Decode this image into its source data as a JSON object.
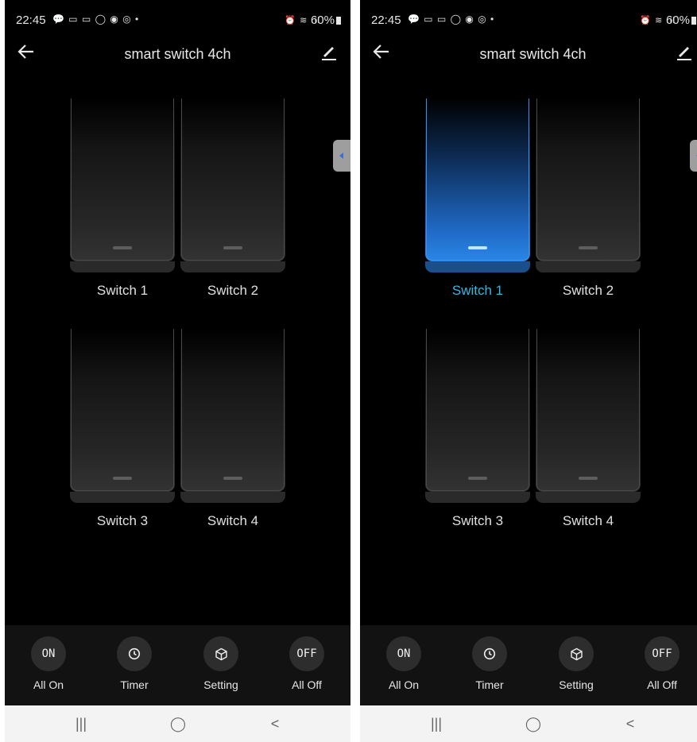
{
  "status": {
    "time": "22:45",
    "notifications": "💬 ▭ ▭ ◯ ◉ ◎ •",
    "system_icons": "⏰ ≋ .ıl",
    "battery": "60%"
  },
  "screens": [
    {
      "title": "smart switch 4ch",
      "switches": [
        {
          "label": "Switch 1",
          "state": "off"
        },
        {
          "label": "Switch 2",
          "state": "off"
        },
        {
          "label": "Switch 3",
          "state": "off"
        },
        {
          "label": "Switch 4",
          "state": "off"
        }
      ]
    },
    {
      "title": "smart switch 4ch",
      "switches": [
        {
          "label": "Switch 1",
          "state": "on"
        },
        {
          "label": "Switch 2",
          "state": "off"
        },
        {
          "label": "Switch 3",
          "state": "off"
        },
        {
          "label": "Switch 4",
          "state": "off"
        }
      ]
    }
  ],
  "actions": {
    "all_on": {
      "icon_text": "ON",
      "label": "All On"
    },
    "timer": {
      "icon": "clock-icon",
      "label": "Timer"
    },
    "setting": {
      "icon": "cube-icon",
      "label": "Setting"
    },
    "all_off": {
      "icon_text": "OFF",
      "label": "All Off"
    }
  },
  "nav": {
    "recents": "|||",
    "home": "◯",
    "back": "<"
  },
  "colors": {
    "background": "#000000",
    "accent_on": "#36b8e6",
    "switch_on": "#1f68c3"
  }
}
